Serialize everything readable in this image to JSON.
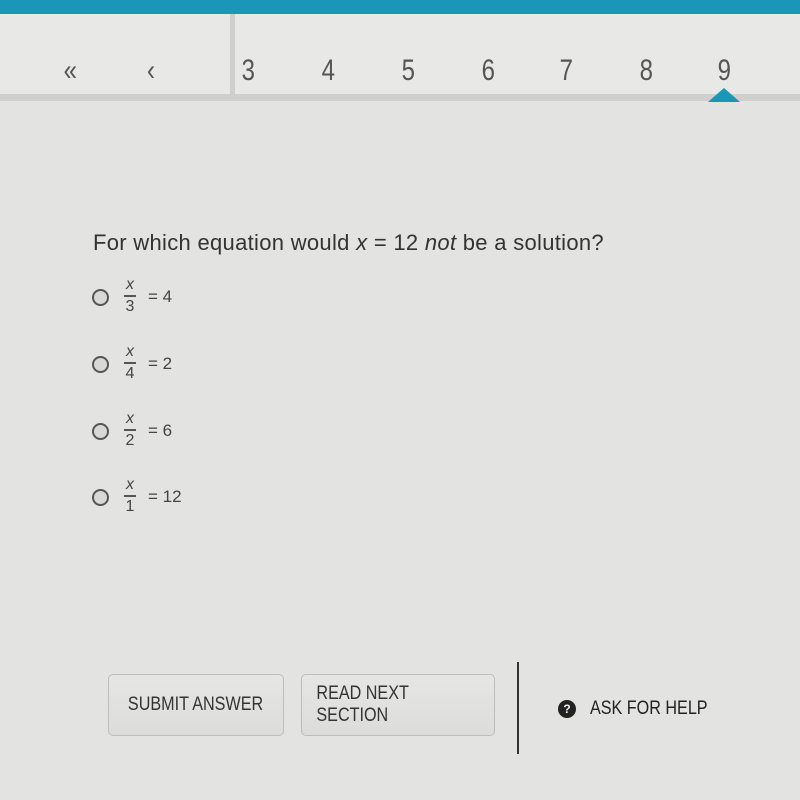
{
  "nav": {
    "first_icon": "«",
    "prev_icon": "‹",
    "pages": [
      "3",
      "4",
      "5",
      "6",
      "7",
      "8",
      "9"
    ],
    "current_page": "9",
    "accent_color": "#1a97b8"
  },
  "question": {
    "prefix": "For which equation would ",
    "variable": "x",
    "middle": " = 12 ",
    "emphasis": "not",
    "suffix": " be a solution?"
  },
  "options": [
    {
      "numerator": "x",
      "denominator": "3",
      "rhs": "= 4"
    },
    {
      "numerator": "x",
      "denominator": "4",
      "rhs": "= 2"
    },
    {
      "numerator": "x",
      "denominator": "2",
      "rhs": "= 6"
    },
    {
      "numerator": "x",
      "denominator": "1",
      "rhs": "= 12"
    }
  ],
  "buttons": {
    "submit": "SUBMIT ANSWER",
    "read_next": "READ NEXT SECTION",
    "help": "ASK FOR HELP",
    "help_icon": "?"
  }
}
